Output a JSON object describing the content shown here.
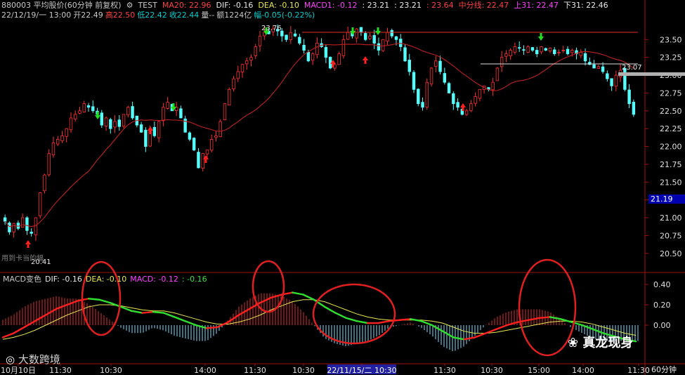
{
  "header": {
    "line1": [
      {
        "text": "880003 平均股价(60分钟 前复权)",
        "color": "#c8c8c8"
      },
      {
        "text": "⚙",
        "color": "#c8c8c8"
      },
      {
        "text": "TEST",
        "color": "#c8c8c8"
      },
      {
        "text": "MA20: 22.96",
        "color": "#ff4040"
      },
      {
        "text": "DIF: -0.16",
        "color": "#e8e8e8"
      },
      {
        "text": "DEA: -0.10",
        "color": "#e8e850"
      },
      {
        "text": "MACD1: -0.12",
        "color": "#ff40ff"
      },
      {
        "text": ": 23.21",
        "color": "#e8e8e8"
      },
      {
        "text": ": 23.21",
        "color": "#e8e8e8"
      },
      {
        "text": ": 23.64",
        "color": "#ff4040"
      },
      {
        "text": "中分线: 22.47",
        "color": "#ff4040"
      },
      {
        "text": "上31: 22.47",
        "color": "#ff40ff"
      },
      {
        "text": "下31: 22.46",
        "color": "#e8e8e8"
      }
    ],
    "line2": [
      {
        "text": "22/12/19/一 13:00",
        "color": "#c8c8c8"
      },
      {
        "text": "开22.49",
        "color": "#c8c8c8"
      },
      {
        "text": "高22.50",
        "color": "#ff4040"
      },
      {
        "text": "低22.42",
        "color": "#00d0d0"
      },
      {
        "text": "收22.44",
        "color": "#00d0d0"
      },
      {
        "text": "量--",
        "color": "#c8c8c8"
      },
      {
        "text": "额1224亿",
        "color": "#c8c8c8"
      },
      {
        "text": "幅-0.05(-0.22%)",
        "color": "#00d0d0"
      }
    ]
  },
  "macd_header": [
    {
      "text": "MACD变色",
      "color": "#c8c8c8"
    },
    {
      "text": "DIF: -0.16",
      "color": "#e8e8e8"
    },
    {
      "text": "DEA: -0.10",
      "color": "#e8e850"
    },
    {
      "text": "MACD: -0.12",
      "color": "#ff40ff"
    },
    {
      "text": ": -0.16",
      "color": "#40e040"
    }
  ],
  "price_panel": {
    "y_ticks": [
      "23.50",
      "23.25",
      "23.00",
      "22.75",
      "22.50",
      "22.25",
      "22.00",
      "21.75",
      "21.50",
      "21.25",
      "21.00",
      "20.75",
      "20.50"
    ],
    "current_price_label": "21.19",
    "high_marker": "23.76",
    "low_marker": "20.41",
    "right_marker": "23.07",
    "watermark_text": "用到卡当的幅"
  },
  "macd_panel": {
    "y_ticks": [
      "0.40",
      "0.20",
      "0.00"
    ]
  },
  "x_axis": {
    "labels": [
      "10月10日",
      "11:30",
      "10:30",
      "14:00",
      "11:30",
      "10:30",
      "22/11/15/二 10:30",
      "11:30",
      "10:30",
      "15:00",
      "14:00",
      "11:30"
    ],
    "period": "60分钟"
  },
  "watermarks": {
    "left": "大数跨境",
    "right": "真龙现身"
  },
  "colors": {
    "up": "#ff3030",
    "down": "#54ffff",
    "ma": "#c02020",
    "dif": "#ffffff",
    "dea": "#e8e850",
    "circle": "#e02020",
    "axis": "#a01010"
  },
  "chart_data": [
    {
      "type": "candlestick",
      "ylim": [
        20.35,
        23.72
      ],
      "closes": [
        20.95,
        20.8,
        20.92,
        20.85,
        21.0,
        20.82,
        20.78,
        21.0,
        21.35,
        21.6,
        21.9,
        22.05,
        22.1,
        22.15,
        22.25,
        22.4,
        22.45,
        22.5,
        22.6,
        22.55,
        22.5,
        22.45,
        22.3,
        22.4,
        22.25,
        22.35,
        22.28,
        22.45,
        22.55,
        22.4,
        22.3,
        22.2,
        22.0,
        22.25,
        22.15,
        22.35,
        22.55,
        22.62,
        22.5,
        22.55,
        22.4,
        22.2,
        22.1,
        21.95,
        21.7,
        21.9,
        21.95,
        22.1,
        22.15,
        22.35,
        22.6,
        22.8,
        22.95,
        23.05,
        23.15,
        23.2,
        23.25,
        23.4,
        23.55,
        23.6,
        23.58,
        23.65,
        23.62,
        23.55,
        23.5,
        23.6,
        23.55,
        23.45,
        23.35,
        23.2,
        23.3,
        23.45,
        23.4,
        23.25,
        23.1,
        23.15,
        23.3,
        23.5,
        23.6,
        23.55,
        23.65,
        23.6,
        23.5,
        23.55,
        23.45,
        23.35,
        23.5,
        23.6,
        23.55,
        23.5,
        23.4,
        23.2,
        23.05,
        22.8,
        22.6,
        22.55,
        22.9,
        23.1,
        23.2,
        23.05,
        22.9,
        22.75,
        22.6,
        22.55,
        22.45,
        22.5,
        22.6,
        22.7,
        22.8,
        22.85,
        22.8,
        22.9,
        23.1,
        23.25,
        23.3,
        23.35,
        23.4,
        23.38,
        23.35,
        23.4,
        23.35,
        23.3,
        23.4,
        23.35,
        23.38,
        23.3,
        23.32,
        23.35,
        23.3,
        23.35,
        23.3,
        23.32,
        23.2,
        23.15,
        23.1,
        23.12,
        23.05,
        22.95,
        22.85,
        23.0,
        23.07,
        22.8,
        22.6,
        22.45
      ]
    },
    {
      "type": "line",
      "series": [
        {
          "name": "DIF",
          "values": [
            -0.12,
            -0.08,
            -0.02,
            0.04,
            0.1,
            0.16,
            0.2,
            0.24,
            0.26,
            0.25,
            0.22,
            0.18,
            0.14,
            0.12,
            0.13,
            0.12,
            0.08,
            0.04,
            0.0,
            -0.03,
            -0.02,
            0.03,
            0.1,
            0.16,
            0.22,
            0.27,
            0.3,
            0.32,
            0.3,
            0.25,
            0.18,
            0.12,
            0.07,
            0.04,
            0.02,
            0.02,
            0.04,
            0.05,
            0.06,
            0.04,
            0.0,
            -0.06,
            -0.12,
            -0.14,
            -0.12,
            -0.08,
            -0.04,
            0.0,
            0.03,
            0.05,
            0.07,
            0.08,
            0.06,
            0.03,
            0.0,
            -0.04,
            -0.08,
            -0.11,
            -0.14,
            -0.16
          ]
        },
        {
          "name": "DEA",
          "values": [
            -0.14,
            -0.12,
            -0.09,
            -0.05,
            0.0,
            0.05,
            0.1,
            0.14,
            0.18,
            0.2,
            0.2,
            0.19,
            0.17,
            0.15,
            0.14,
            0.14,
            0.12,
            0.09,
            0.06,
            0.03,
            0.01,
            0.01,
            0.03,
            0.06,
            0.1,
            0.15,
            0.19,
            0.23,
            0.25,
            0.25,
            0.23,
            0.19,
            0.15,
            0.11,
            0.08,
            0.06,
            0.05,
            0.05,
            0.05,
            0.05,
            0.04,
            0.02,
            -0.02,
            -0.06,
            -0.08,
            -0.08,
            -0.07,
            -0.05,
            -0.03,
            -0.01,
            0.01,
            0.03,
            0.04,
            0.04,
            0.03,
            0.01,
            -0.02,
            -0.05,
            -0.08,
            -0.1
          ]
        }
      ]
    }
  ]
}
